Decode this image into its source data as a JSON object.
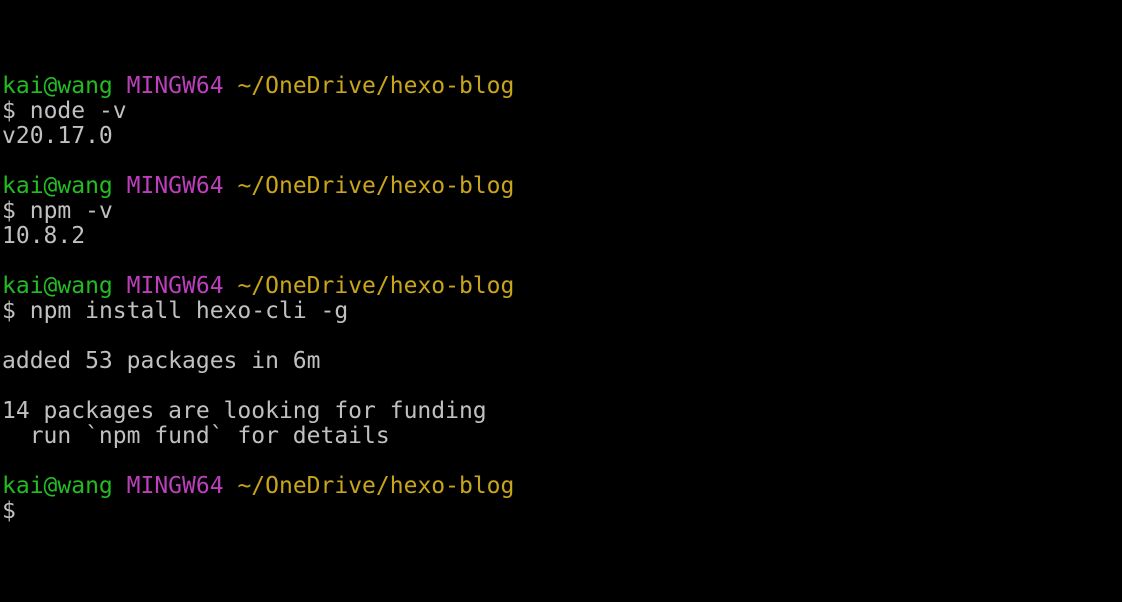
{
  "prompt": {
    "user": "kai@wang",
    "host": "MINGW64",
    "path": "~/OneDrive/hexo-blog",
    "symbol": "$"
  },
  "blocks": [
    {
      "command": "node -v",
      "output": [
        "v20.17.0"
      ]
    },
    {
      "command": "npm -v",
      "output": [
        "10.8.2"
      ]
    },
    {
      "command": "npm install hexo-cli -g",
      "output": [
        "",
        "added 53 packages in 6m",
        "",
        "14 packages are looking for funding",
        "  run `npm fund` for details"
      ]
    },
    {
      "command": "",
      "output": []
    }
  ],
  "colors": {
    "background": "#000000",
    "text": "#c0c0c0",
    "user": "#23bc23",
    "host": "#bc3fbc",
    "path": "#c9a51b"
  }
}
